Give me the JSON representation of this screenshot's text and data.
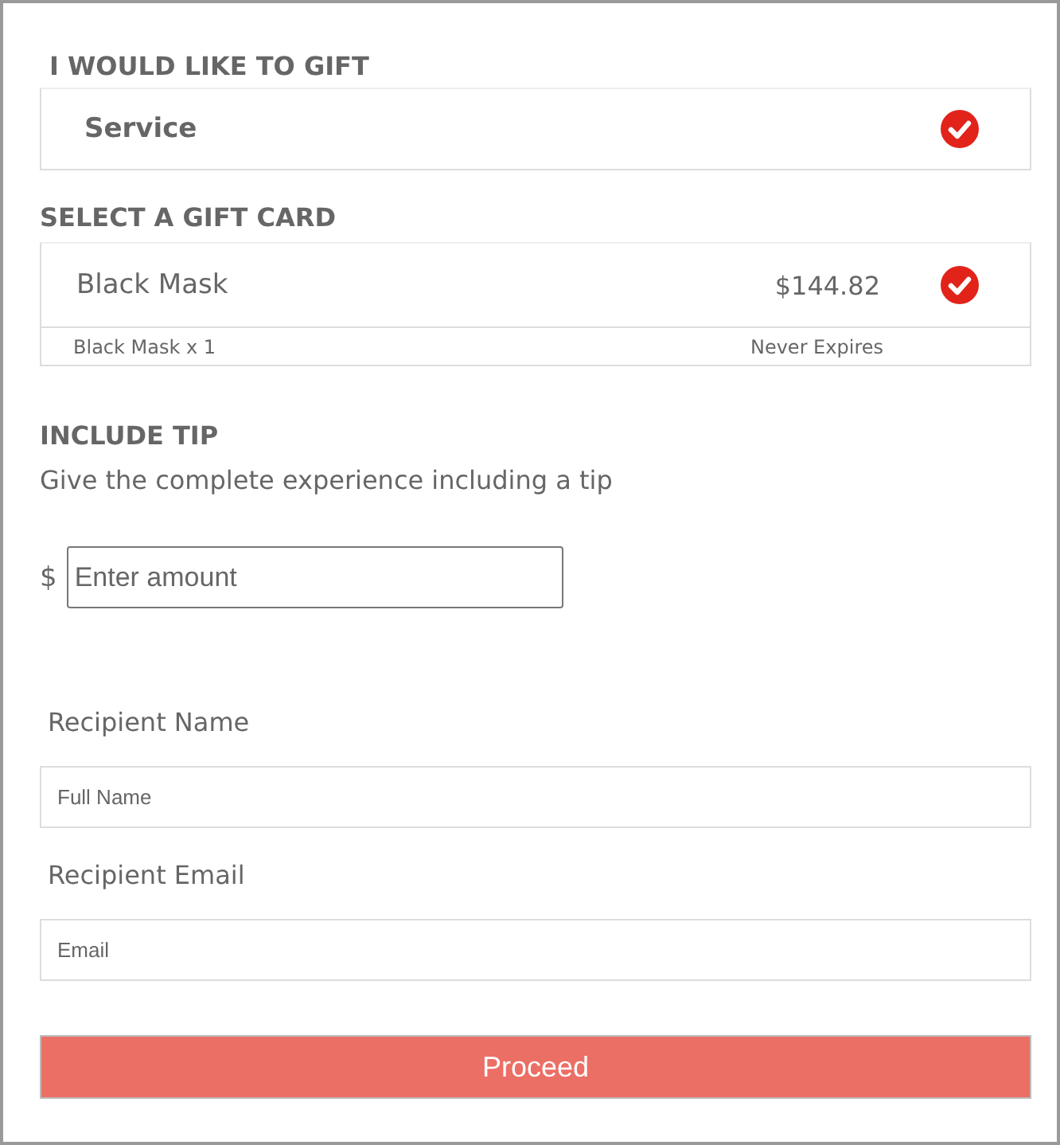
{
  "gift_type": {
    "heading": "I WOULD LIKE TO GIFT",
    "option": {
      "label": "Service",
      "selected": true
    }
  },
  "gift_card": {
    "heading": "SELECT A GIFT CARD",
    "card": {
      "name": "Black Mask",
      "price": "$144.82",
      "selected": true,
      "quantity": "Black Mask x 1",
      "expiry": "Never Expires"
    }
  },
  "tip": {
    "heading": "INCLUDE TIP",
    "description": "Give the complete experience including a tip",
    "currency": "$",
    "placeholder": "Enter amount"
  },
  "recipient_name": {
    "label": "Recipient Name",
    "placeholder": "Full Name"
  },
  "recipient_email": {
    "label": "Recipient Email",
    "placeholder": "Email"
  },
  "button": "Proceed"
}
